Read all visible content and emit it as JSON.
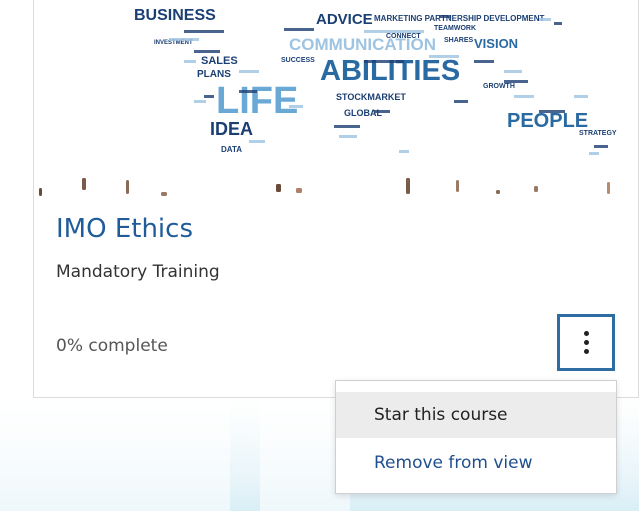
{
  "course": {
    "title": "IMO Ethics",
    "category": "Mandatory Training",
    "progress_percent": 0,
    "progress_label": "0% complete",
    "image": {
      "words": [
        "BUSINESS",
        "ADVICE",
        "MARKETING PARTNERSHIP DEVELOPMENT",
        "COMMUNICATION",
        "ABILITIES",
        "SALES",
        "PLANS",
        "LIFE",
        "IDEA",
        "DATA",
        "STOCKMARKET",
        "GLOBAL",
        "VISION",
        "SHARES",
        "PEOPLE",
        "CONNECT",
        "TEAMWORK",
        "INVESTMENT",
        "SUCCESS",
        "GROWTH",
        "STRATEGY"
      ]
    }
  },
  "actions_menu": {
    "icon": "vertical-ellipsis-icon",
    "items": [
      {
        "label": "Star this course"
      },
      {
        "label": "Remove from view"
      }
    ]
  },
  "colors": {
    "title": "#1f5c99",
    "menu_border": "#2e6da4",
    "link": "#1f4f8f",
    "hover": "#ececec",
    "word_cloud": [
      "#1b3f73",
      "#2a6aa3",
      "#6aa8d6",
      "#9ec4e2"
    ]
  }
}
